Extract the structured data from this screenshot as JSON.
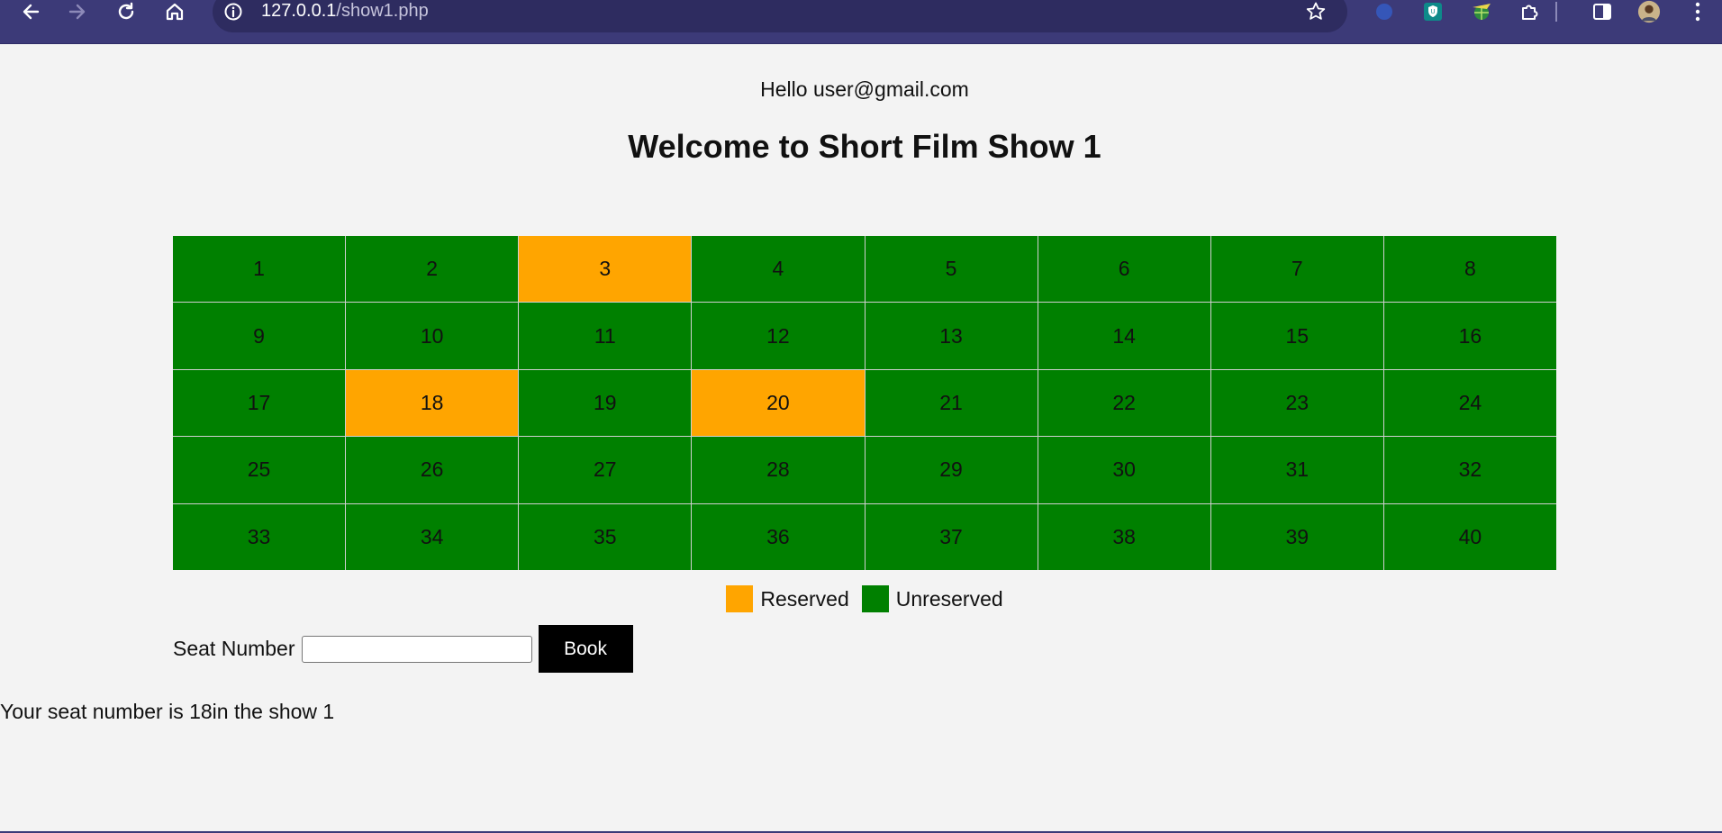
{
  "browser": {
    "url_host": "127.0.0.1",
    "url_path": "/show1.php"
  },
  "header": {
    "greeting": "Hello user@gmail.com",
    "title": "Welcome to Short Film Show 1"
  },
  "colors": {
    "reserved": "#ffa500",
    "unreserved": "#008000",
    "browser_bar": "#3c3a78"
  },
  "seats": [
    {
      "number": "1",
      "status": "unreserved"
    },
    {
      "number": "2",
      "status": "unreserved"
    },
    {
      "number": "3",
      "status": "reserved"
    },
    {
      "number": "4",
      "status": "unreserved"
    },
    {
      "number": "5",
      "status": "unreserved"
    },
    {
      "number": "6",
      "status": "unreserved"
    },
    {
      "number": "7",
      "status": "unreserved"
    },
    {
      "number": "8",
      "status": "unreserved"
    },
    {
      "number": "9",
      "status": "unreserved"
    },
    {
      "number": "10",
      "status": "unreserved"
    },
    {
      "number": "11",
      "status": "unreserved"
    },
    {
      "number": "12",
      "status": "unreserved"
    },
    {
      "number": "13",
      "status": "unreserved"
    },
    {
      "number": "14",
      "status": "unreserved"
    },
    {
      "number": "15",
      "status": "unreserved"
    },
    {
      "number": "16",
      "status": "unreserved"
    },
    {
      "number": "17",
      "status": "unreserved"
    },
    {
      "number": "18",
      "status": "reserved"
    },
    {
      "number": "19",
      "status": "unreserved"
    },
    {
      "number": "20",
      "status": "reserved"
    },
    {
      "number": "21",
      "status": "unreserved"
    },
    {
      "number": "22",
      "status": "unreserved"
    },
    {
      "number": "23",
      "status": "unreserved"
    },
    {
      "number": "24",
      "status": "unreserved"
    },
    {
      "number": "25",
      "status": "unreserved"
    },
    {
      "number": "26",
      "status": "unreserved"
    },
    {
      "number": "27",
      "status": "unreserved"
    },
    {
      "number": "28",
      "status": "unreserved"
    },
    {
      "number": "29",
      "status": "unreserved"
    },
    {
      "number": "30",
      "status": "unreserved"
    },
    {
      "number": "31",
      "status": "unreserved"
    },
    {
      "number": "32",
      "status": "unreserved"
    },
    {
      "number": "33",
      "status": "unreserved"
    },
    {
      "number": "34",
      "status": "unreserved"
    },
    {
      "number": "35",
      "status": "unreserved"
    },
    {
      "number": "36",
      "status": "unreserved"
    },
    {
      "number": "37",
      "status": "unreserved"
    },
    {
      "number": "38",
      "status": "unreserved"
    },
    {
      "number": "39",
      "status": "unreserved"
    },
    {
      "number": "40",
      "status": "unreserved"
    }
  ],
  "legend": {
    "reserved_label": "Reserved",
    "unreserved_label": "Unreserved"
  },
  "form": {
    "seat_label": "Seat Number",
    "seat_value": "",
    "book_label": "Book"
  },
  "result": {
    "message": "Your seat number is 18in the show 1"
  }
}
